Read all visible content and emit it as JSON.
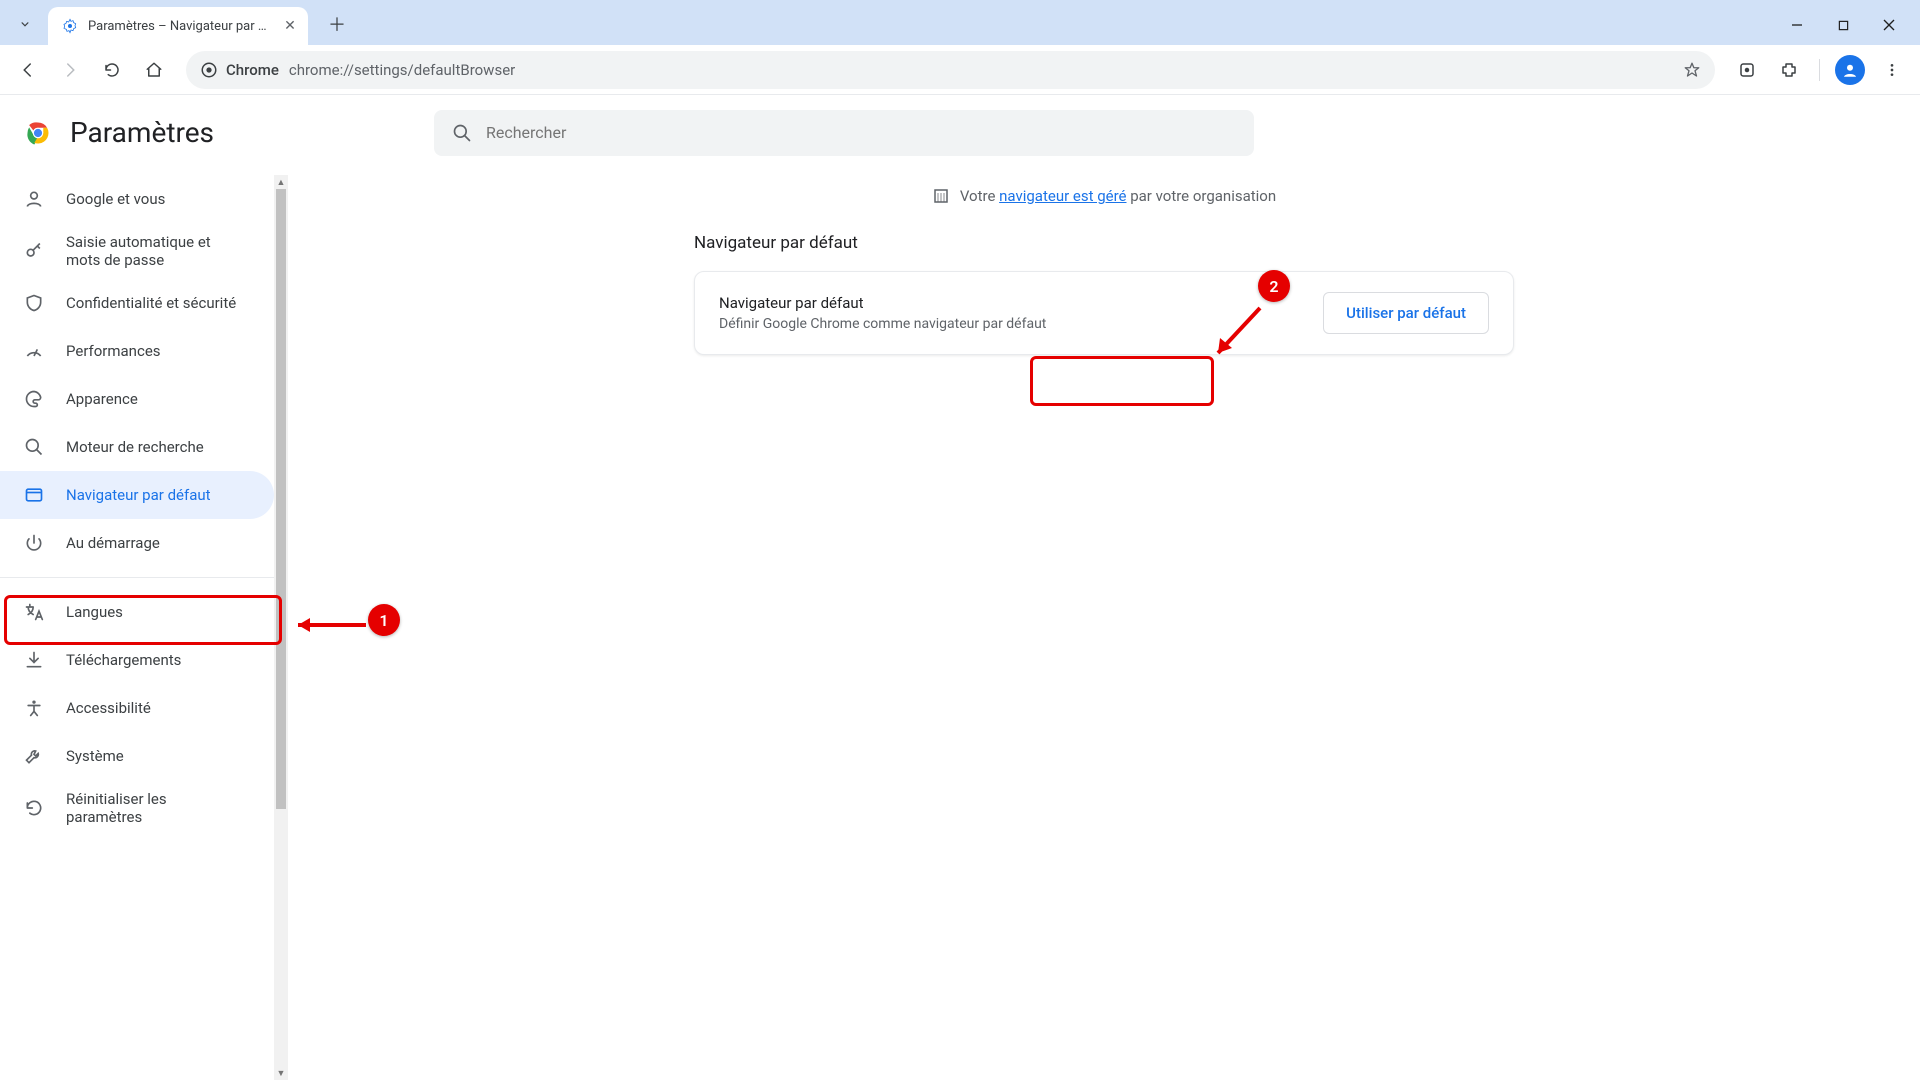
{
  "window": {
    "tab_title": "Paramètres – Navigateur par dé",
    "url_label": "Chrome",
    "url": "chrome://settings/defaultBrowser"
  },
  "settings": {
    "page_title": "Paramètres",
    "search_placeholder": "Rechercher",
    "managed_prefix": "Votre ",
    "managed_link": "navigateur est géré",
    "managed_suffix": " par votre organisation",
    "section_title": "Navigateur par défaut",
    "card_title": "Navigateur par défaut",
    "card_subtitle": "Définir Google Chrome comme navigateur par défaut",
    "default_button": "Utiliser par défaut"
  },
  "sidebar": {
    "items": [
      {
        "label": "Google et vous"
      },
      {
        "label": "Saisie automatique et mots de passe"
      },
      {
        "label": "Confidentialité et sécurité"
      },
      {
        "label": "Performances"
      },
      {
        "label": "Apparence"
      },
      {
        "label": "Moteur de recherche"
      },
      {
        "label": "Navigateur par défaut"
      },
      {
        "label": "Au démarrage"
      },
      {
        "label": "Langues"
      },
      {
        "label": "Téléchargements"
      },
      {
        "label": "Accessibilité"
      },
      {
        "label": "Système"
      },
      {
        "label": "Réinitialiser les paramètres"
      }
    ]
  },
  "annotations": {
    "one": "1",
    "two": "2"
  }
}
